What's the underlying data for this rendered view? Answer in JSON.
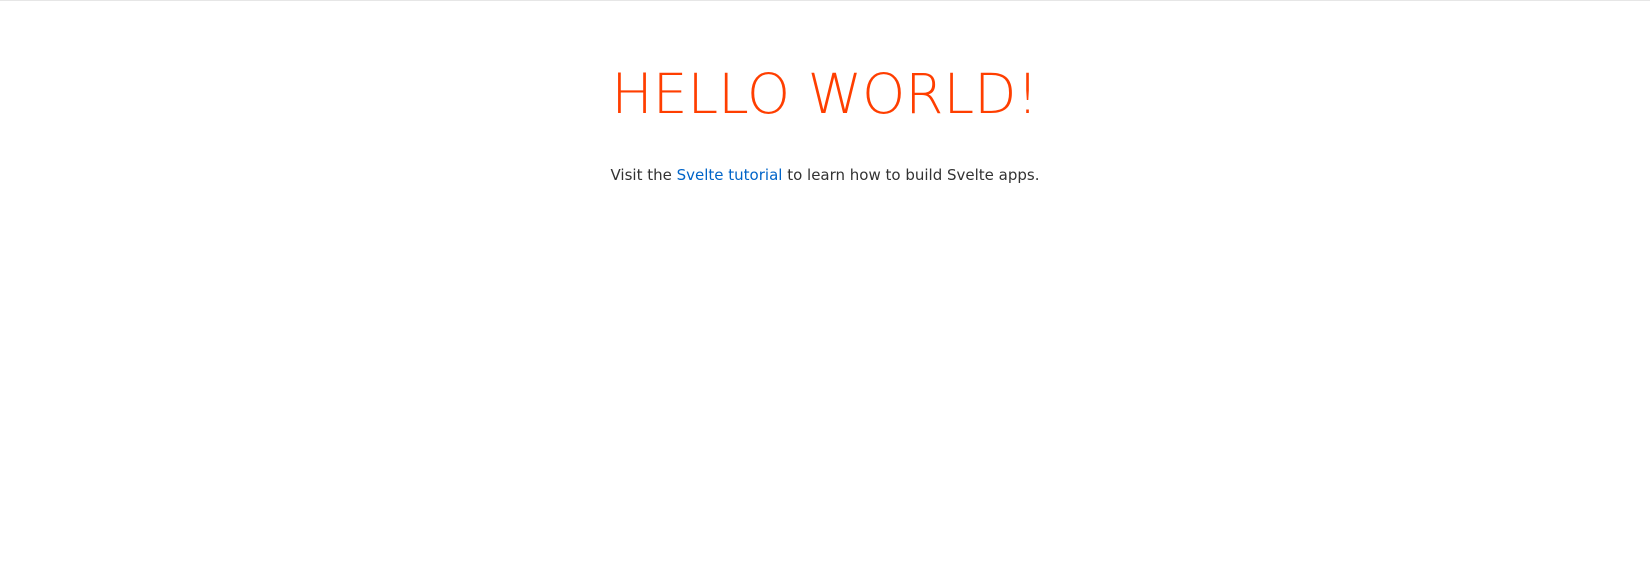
{
  "app": {
    "heading": "HELLO WORLD!",
    "intro": {
      "prefix": "Visit the ",
      "link_text": "Svelte tutorial",
      "suffix": " to learn how to build Svelte apps."
    }
  },
  "colors": {
    "heading": "#ff3e00",
    "link": "#0064c8",
    "text": "#333333",
    "background": "#ffffff"
  }
}
